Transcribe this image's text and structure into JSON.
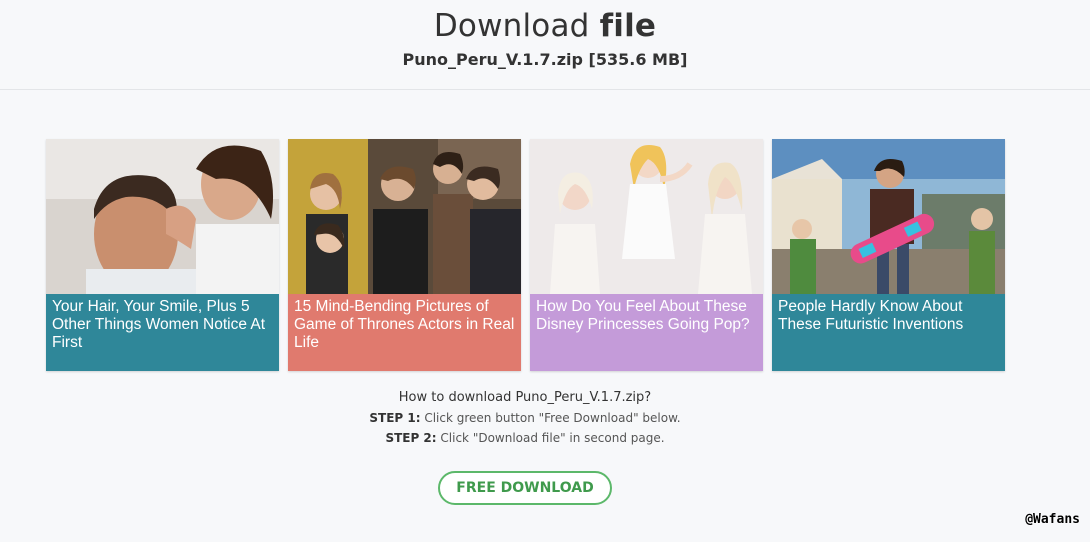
{
  "header": {
    "title_light": "Download ",
    "title_bold": "file",
    "filename": "Puno_Peru_V.1.7.zip [535.6 MB]"
  },
  "cards": [
    {
      "caption": "Your Hair, Your Smile, Plus 5 Other Things Women Notice At First",
      "color": "#2f8799"
    },
    {
      "caption": "15 Mind-Bending Pictures of Game of Thrones Actors in Real Life",
      "color": "#e07a6e"
    },
    {
      "caption": "How Do You Feel About These Disney Princesses Going Pop?",
      "color": "#c49bd9"
    },
    {
      "caption": "People Hardly Know About These Futuristic Inventions",
      "color": "#2f8799"
    }
  ],
  "howto": {
    "question": "How to download Puno_Peru_V.1.7.zip?",
    "step1_label": "STEP 1:",
    "step1_text": " Click green button \"Free Download\" below.",
    "step2_label": "STEP 2:",
    "step2_text": " Click \"Download file\" in second page."
  },
  "download_button": "FREE DOWNLOAD",
  "watermark": "@Wafans"
}
